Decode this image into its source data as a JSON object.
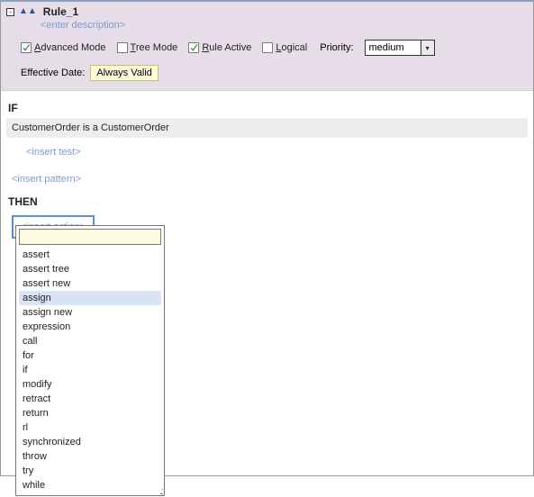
{
  "rule": {
    "name": "Rule_1",
    "description_placeholder": "<enter description>"
  },
  "options": {
    "advanced_label": "dvanced Mode",
    "advanced_ul": "A",
    "tree_label": "ree Mode",
    "tree_ul": "T",
    "active_label": "ule Active",
    "active_ul": "R",
    "logical_label": "ogical",
    "logical_ul": "L",
    "priority_label": "Priority:",
    "priority_value": "medium"
  },
  "effective": {
    "label": "Effective Date:",
    "value": "Always Valid"
  },
  "if_label": "IF",
  "condition": "CustomerOrder is a CustomerOrder",
  "insert_test": "<insert test>",
  "insert_pattern": "<insert pattern>",
  "then_label": "THEN",
  "insert_action": "<insert action>",
  "actions": {
    "items": [
      "assert",
      "assert tree",
      "assert new",
      "assign",
      "assign new",
      "expression",
      "call",
      "for",
      "if",
      "modify",
      "retract",
      "return",
      "rl",
      "synchronized",
      "throw",
      "try",
      "while"
    ],
    "selected_index": 3,
    "filter": ""
  }
}
